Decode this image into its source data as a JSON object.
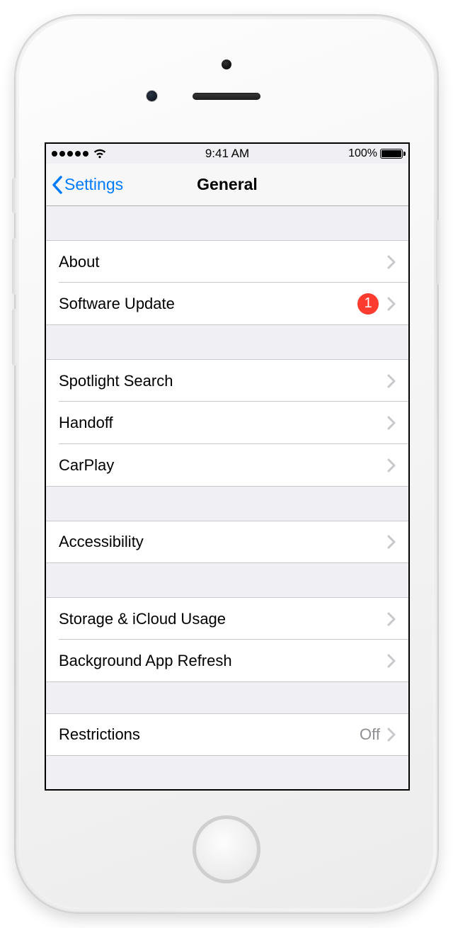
{
  "status": {
    "time": "9:41 AM",
    "battery_pct": "100%"
  },
  "nav": {
    "back_label": "Settings",
    "title": "General"
  },
  "groups": [
    {
      "rows": [
        {
          "id": "about",
          "label": "About"
        },
        {
          "id": "software-update",
          "label": "Software Update",
          "badge": "1"
        }
      ]
    },
    {
      "rows": [
        {
          "id": "spotlight-search",
          "label": "Spotlight Search"
        },
        {
          "id": "handoff",
          "label": "Handoff"
        },
        {
          "id": "carplay",
          "label": "CarPlay"
        }
      ]
    },
    {
      "rows": [
        {
          "id": "accessibility",
          "label": "Accessibility"
        }
      ]
    },
    {
      "rows": [
        {
          "id": "storage-icloud-usage",
          "label": "Storage & iCloud Usage"
        },
        {
          "id": "background-app-refresh",
          "label": "Background App Refresh"
        }
      ]
    },
    {
      "rows": [
        {
          "id": "restrictions",
          "label": "Restrictions",
          "detail": "Off"
        }
      ]
    }
  ],
  "colors": {
    "tint": "#007aff",
    "badge": "#ff3b30",
    "separator": "#c8c7cc",
    "grouped_bg": "#efeff4"
  }
}
